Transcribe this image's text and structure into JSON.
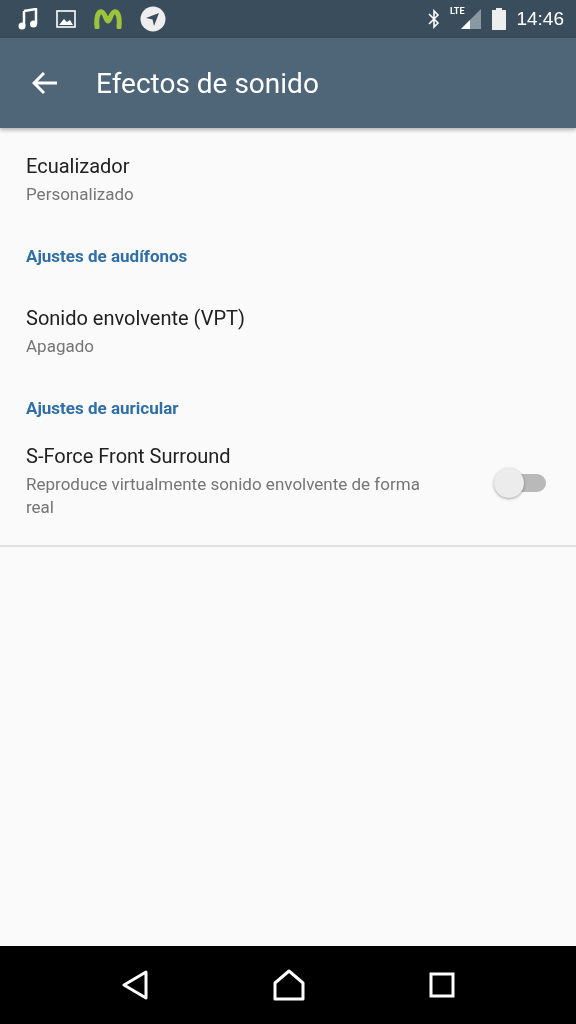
{
  "status_bar": {
    "network": "LTE",
    "time": "14:46"
  },
  "toolbar": {
    "title": "Efectos de sonido"
  },
  "preferences": [
    {
      "kind": "item",
      "title": "Ecualizador",
      "summary": "Personalizado"
    },
    {
      "kind": "header",
      "title": "Ajustes de audífonos"
    },
    {
      "kind": "item",
      "title": "Sonido envolvente (VPT)",
      "summary": "Apagado"
    },
    {
      "kind": "header",
      "title": "Ajustes de auricular"
    },
    {
      "kind": "switch",
      "title": "S-Force Front Surround",
      "summary": "Reproduce virtualmente sonido envolvente de forma real",
      "on": false
    }
  ]
}
